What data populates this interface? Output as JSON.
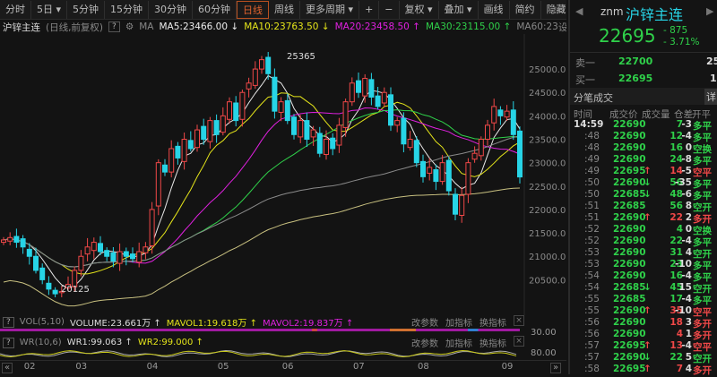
{
  "toolbar": {
    "items": [
      "分时",
      "5日 ▾",
      "5分钟",
      "15分钟",
      "30分钟",
      "60分钟",
      "日线",
      "周线",
      "更多周期 ▾",
      "+",
      "−",
      "复权 ▾",
      "叠加 ▾",
      "画线",
      "简约",
      "隐藏 ▸▸",
      "⛶"
    ],
    "active_index": 6
  },
  "info": {
    "name": "沪锌主连",
    "mode": "(日线,前复权)",
    "help": "?",
    "ma_label": "MA",
    "ma5": "MA5:23466.00 ↓",
    "ma10": "MA10:23763.50 ↓",
    "ma20": "MA20:23458.50 ↑",
    "ma30": "MA30:23115.00 ↑",
    "ma60": "MA60:23",
    "settings": "设置均线 ▾"
  },
  "chart_data": {
    "type": "candlestick",
    "high_label": "25365",
    "low_label": "20125",
    "y_ticks": [
      25000,
      24500,
      24000,
      23500,
      23000,
      22500,
      22000,
      21500,
      21000,
      20500
    ],
    "y_tick_labels": [
      "25000.0",
      "24500.0",
      "24000.0",
      "23500.0",
      "23000.0",
      "22500.0",
      "22000.0",
      "21500.0",
      "21000.0",
      "20500.0"
    ],
    "x_labels": [
      "02",
      "03",
      "04",
      "05",
      "06",
      "07",
      "08",
      "09"
    ],
    "x_label_index": [
      4,
      12,
      23,
      34,
      44,
      55,
      65,
      78
    ],
    "closes": [
      21350,
      21400,
      21300,
      21200,
      21000,
      20700,
      20500,
      20300,
      20200,
      20250,
      20400,
      20700,
      21000,
      21200,
      21300,
      21100,
      21000,
      20900,
      21100,
      21000,
      20950,
      21100,
      21200,
      22000,
      23000,
      22800,
      23300,
      23100,
      23500,
      23300,
      23700,
      23500,
      23900,
      23600,
      24000,
      24300,
      23900,
      24500,
      24700,
      25000,
      25200,
      24900,
      24100,
      24300,
      23900,
      23600,
      23900,
      23500,
      23700,
      23200,
      23500,
      23300,
      23800,
      24300,
      24700,
      24500,
      24800,
      24400,
      24200,
      24500,
      23800,
      23900,
      23400,
      23500,
      23000,
      22700,
      22900,
      22600,
      23000,
      22400,
      21900,
      22300,
      23000,
      23200,
      23500,
      23800,
      24200,
      24000,
      24100,
      23600,
      22695
    ],
    "high": 25365,
    "low": 20125
  },
  "volume": {
    "help": "?",
    "name": "VOL(5,10)",
    "volume": "VOLUME:23.661万 ↑",
    "mavol1": "MAVOL1:19.618万 ↑",
    "mavol2": "MAVOL2:19.837万 ↑",
    "axis": "30.00"
  },
  "wr": {
    "help": "?",
    "name": "WR(10,6)",
    "wr1": "WR1:99.063 ↑",
    "wr2": "WR2:99.000 ↑",
    "axis": "80.00"
  },
  "panel_buttons": {
    "edit": "改参数",
    "add": "加指标",
    "swap": "换指标",
    "close": "×"
  },
  "nav": {
    "left": "«",
    "right": "»"
  },
  "quote": {
    "code": "znm",
    "name": "沪锌主连",
    "price": "22695",
    "change": "- 875",
    "pct": "- 3.71%",
    "sell_label": "卖一",
    "sell_price": "22700",
    "sell_vol": "25",
    "buy_label": "买一",
    "buy_price": "22695",
    "buy_vol": "1",
    "ticks_title": "分笔成交",
    "detail": "详",
    "cols": [
      "时间",
      "成交价",
      "成交量",
      "仓差",
      "开平"
    ]
  },
  "ticks": [
    [
      "14:59",
      "22690",
      "",
      "7",
      "g",
      "-3",
      "多平",
      "g"
    ],
    [
      ":48",
      "22690",
      "",
      "12",
      "g",
      "-4",
      "多平",
      "g"
    ],
    [
      ":48",
      "22690",
      "",
      "16",
      "g",
      "0",
      "空换",
      "g"
    ],
    [
      ":49",
      "22690",
      "",
      "24",
      "g",
      "-8",
      "多平",
      "g"
    ],
    [
      ":49",
      "22695",
      "↑",
      "14",
      "r",
      "-5",
      "空平",
      "r"
    ],
    [
      ":50",
      "22690",
      "↓",
      "56",
      "g",
      "-35",
      "多平",
      "g"
    ],
    [
      ":50",
      "22685",
      "↓",
      "48",
      "g",
      "-6",
      "多平",
      "g"
    ],
    [
      ":51",
      "22685",
      "",
      "56",
      "g",
      "8",
      "空开",
      "g"
    ],
    [
      ":51",
      "22690",
      "↑",
      "22",
      "r",
      "2",
      "多开",
      "r"
    ],
    [
      ":52",
      "22690",
      "",
      "4",
      "g",
      "0",
      "空换",
      "g"
    ],
    [
      ":52",
      "22690",
      "",
      "22",
      "g",
      "-4",
      "多平",
      "g"
    ],
    [
      ":53",
      "22690",
      "",
      "31",
      "g",
      "4",
      "空开",
      "g"
    ],
    [
      ":53",
      "22690",
      "",
      "23",
      "g",
      "-10",
      "多平",
      "g"
    ],
    [
      ":54",
      "22690",
      "",
      "16",
      "g",
      "-4",
      "多平",
      "g"
    ],
    [
      ":54",
      "22685",
      "↓",
      "45",
      "g",
      "15",
      "空开",
      "g"
    ],
    [
      ":55",
      "22685",
      "",
      "17",
      "g",
      "-4",
      "多平",
      "g"
    ],
    [
      ":55",
      "22690",
      "↑",
      "35",
      "r",
      "-10",
      "空平",
      "r"
    ],
    [
      ":56",
      "22690",
      "",
      "18",
      "r",
      "3",
      "多开",
      "r"
    ],
    [
      ":56",
      "22690",
      "",
      "4",
      "r",
      "1",
      "多开",
      "r"
    ],
    [
      ":57",
      "22695",
      "↑",
      "13",
      "r",
      "-4",
      "空平",
      "r"
    ],
    [
      ":57",
      "22690",
      "↓",
      "22",
      "g",
      "5",
      "空开",
      "g"
    ],
    [
      ":58",
      "22695",
      "↑",
      "7",
      "r",
      "4",
      "多开",
      "r"
    ]
  ]
}
